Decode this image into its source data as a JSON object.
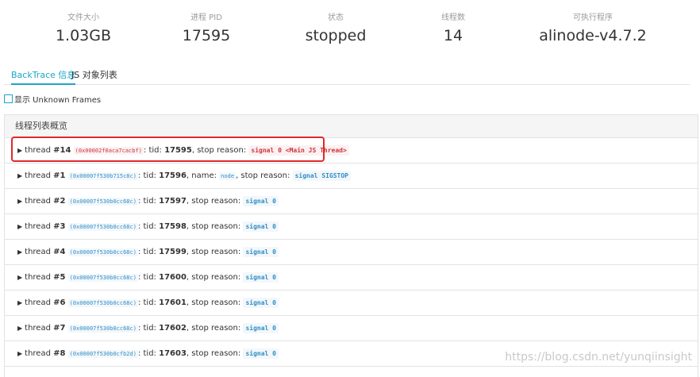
{
  "stats": [
    {
      "label": "文件大小",
      "value": "1.03GB"
    },
    {
      "label": "进程 PID",
      "value": "17595"
    },
    {
      "label": "状态",
      "value": "stopped"
    },
    {
      "label": "线程数",
      "value": "14"
    },
    {
      "label": "可执行程序",
      "value": "alinode-v4.7.2"
    }
  ],
  "tabs": [
    {
      "label": "BackTrace 信息",
      "active": true
    },
    {
      "label": "JS 对象列表",
      "active": false
    }
  ],
  "checkbox": {
    "label": "显示 Unknown Frames",
    "checked": false
  },
  "panel": {
    "title": "线程列表概览"
  },
  "text": {
    "thread": "thread",
    "tid": ": tid: ",
    "stop_reason": ", stop reason: ",
    "name": ", name: ",
    "stop_reason_alt": ",  stop reason: "
  },
  "threads": [
    {
      "num": "#14",
      "addr": "(0x00002f0aca7cacbf)",
      "tid": "17595",
      "name": "",
      "signal": "signal 0 <Main JS Thread>",
      "highlight": true
    },
    {
      "num": "#1",
      "addr": "(0x00007f530b715c8c)",
      "tid": "17596",
      "name": "node",
      "signal": "signal SIGSTOP",
      "highlight": false
    },
    {
      "num": "#2",
      "addr": "(0x00007f530b0cc68c)",
      "tid": "17597",
      "name": "",
      "signal": "signal 0",
      "highlight": false
    },
    {
      "num": "#3",
      "addr": "(0x00007f530b0cc68c)",
      "tid": "17598",
      "name": "",
      "signal": "signal 0",
      "highlight": false
    },
    {
      "num": "#4",
      "addr": "(0x00007f530b0cc68c)",
      "tid": "17599",
      "name": "",
      "signal": "signal 0",
      "highlight": false
    },
    {
      "num": "#5",
      "addr": "(0x00007f530b0cc68c)",
      "tid": "17600",
      "name": "",
      "signal": "signal 0",
      "highlight": false
    },
    {
      "num": "#6",
      "addr": "(0x00007f530b0cc68c)",
      "tid": "17601",
      "name": "",
      "signal": "signal 0",
      "highlight": false
    },
    {
      "num": "#7",
      "addr": "(0x00007f530b0cc68c)",
      "tid": "17602",
      "name": "",
      "signal": "signal 0",
      "highlight": false
    },
    {
      "num": "#8",
      "addr": "(0x00007f530b0cfb2d)",
      "tid": "17603",
      "name": "",
      "signal": "signal 0",
      "highlight": false
    }
  ],
  "watermark": "https://blog.csdn.net/yunqiinsight",
  "colors": {
    "accent": "#1aa6c9",
    "highlight": "#e0282e",
    "signal_blue": "#2f8fc4",
    "signal_red": "#d0353b"
  }
}
